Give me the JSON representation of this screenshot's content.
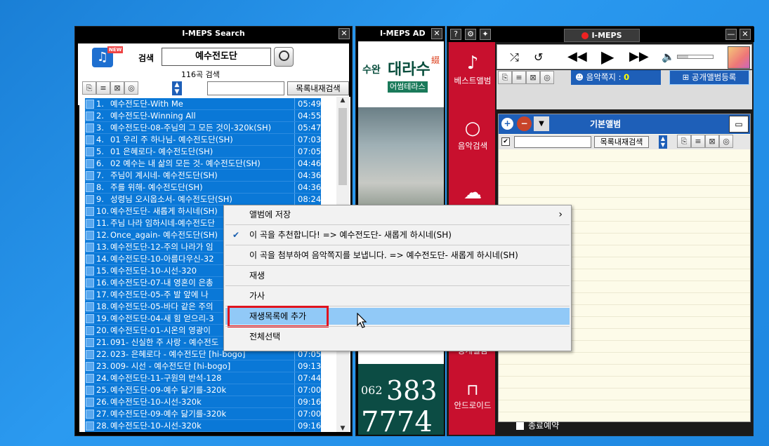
{
  "search_window": {
    "title": "I-MEPS Search",
    "close": "✕",
    "new_badge": "NEW",
    "search_label": "검색",
    "search_value": "예수전도단",
    "result_count": "116곡 검색",
    "filter_placeholder": "",
    "inlist_search_button": "목록내재검색",
    "rows": [
      {
        "num": "1.",
        "title": "예수전도단-With Me",
        "dur": "05:49"
      },
      {
        "num": "2.",
        "title": "예수전도단-Winning All",
        "dur": "04:55"
      },
      {
        "num": "3.",
        "title": "예수전도단-08-주님의 그 모든 것이-320k(SH)",
        "dur": "05:47"
      },
      {
        "num": "4.",
        "title": "01 우리 주 하나님- 예수전도단(SH)",
        "dur": "07:03"
      },
      {
        "num": "5.",
        "title": "01 은혜로다- 예수전도단(SH)",
        "dur": "07:05"
      },
      {
        "num": "6.",
        "title": "02 예수는 내 삶의 모든 것- 예수전도단(SH)",
        "dur": "04:46"
      },
      {
        "num": "7.",
        "title": "주님이 계시네- 예수전도단(SH)",
        "dur": "04:36"
      },
      {
        "num": "8.",
        "title": "주를 위해- 예수전도단(SH)",
        "dur": "04:36"
      },
      {
        "num": "9.",
        "title": "성령님 오시옵소서- 예수전도단(SH)",
        "dur": "08:24"
      },
      {
        "num": "10.",
        "title": "예수전도단- 새롭게 하시네(SH)",
        "dur": ""
      },
      {
        "num": "11.",
        "title": "주님 나라 임하시네-예수전도단",
        "dur": ""
      },
      {
        "num": "12.",
        "title": "Once_again- 예수전도단(SH)",
        "dur": ""
      },
      {
        "num": "13.",
        "title": "예수전도단-12-주의 나라가 임",
        "dur": ""
      },
      {
        "num": "14.",
        "title": "예수전도단-10-아름다우신-32",
        "dur": ""
      },
      {
        "num": "15.",
        "title": "예수전도단-10-시선-320",
        "dur": ""
      },
      {
        "num": "16.",
        "title": "예수전도단-07-내 영혼이 은총",
        "dur": ""
      },
      {
        "num": "17.",
        "title": "예수전도단-05-주 발 앞에 나",
        "dur": ""
      },
      {
        "num": "18.",
        "title": "예수전도단-05-바다 같은 주의",
        "dur": ""
      },
      {
        "num": "19.",
        "title": "예수전도단-04-새 힘 얻으리-3",
        "dur": ""
      },
      {
        "num": "20.",
        "title": "예수전도단-01-시온의 영광이",
        "dur": ""
      },
      {
        "num": "21.",
        "title": "091- 신실한 주 사랑 - 예수전도",
        "dur": ""
      },
      {
        "num": "22.",
        "title": "023- 은혜로다 - 예수전도단 [hi-bogo]",
        "dur": "07:05"
      },
      {
        "num": "23.",
        "title": "009- 시선 - 예수전도단 [hi-bogo]",
        "dur": "09:13"
      },
      {
        "num": "24.",
        "title": "예수전도단-11-구원의 반석-128",
        "dur": "07:44"
      },
      {
        "num": "25.",
        "title": "예수전도단-09-예수 닮기를-320k",
        "dur": "07:00"
      },
      {
        "num": "26.",
        "title": "예수전도단-10-시선-320k",
        "dur": "09:16"
      },
      {
        "num": "27.",
        "title": "예수전도단-09-예수 닮기를-320k",
        "dur": "07:00"
      },
      {
        "num": "28.",
        "title": "예수전도단-10-시선-320k",
        "dur": "09:16"
      }
    ]
  },
  "ad_window": {
    "title": "I-MEPS AD",
    "close": "✕",
    "brand_small": "수완",
    "brand_big": "대라수",
    "brand_sub": "어썸테라스",
    "seal": "綴",
    "phone_area": "062",
    "phone_1": "383",
    "phone_2": "7774"
  },
  "main_window": {
    "title": "I-MEPS",
    "help": "?",
    "settings": "⚙",
    "pin": "✦",
    "minimize": "—",
    "close": "✕",
    "sidebar": [
      {
        "label": "베스트앨범",
        "icon": "♪"
      },
      {
        "label": "음악검색",
        "icon": "○"
      },
      {
        "label": "",
        "icon": "☁"
      },
      {
        "label": "공개앨범",
        "icon": ""
      },
      {
        "label": "안드로이드",
        "icon": "⊓"
      }
    ],
    "message_label": "음악쪽지 :",
    "message_count": "0",
    "public_album_button": "공개앨범등록",
    "album_title": "기본앨범",
    "album_inlist_search": "목록내재검색",
    "shutdown_label": "종료예약"
  },
  "context_menu": {
    "items": [
      {
        "label": "앨범에 저장",
        "arrow": "›"
      },
      {
        "label": "이 곡을 추천합니다! => 예수전도단- 새롭게 하시네(SH)",
        "check": "✔"
      },
      {
        "label": "이 곡을 첨부하여 음악쪽지를 보냅니다. => 예수전도단- 새롭게 하시네(SH)"
      },
      {
        "label": "재생"
      },
      {
        "label": "가사"
      },
      {
        "label": "재생목록에 추가"
      },
      {
        "label": "전체선택"
      }
    ]
  },
  "colors": {
    "accent": "#0a78d7",
    "highlight": "#e0141e",
    "sidebar": "#c8102e",
    "menu_hover": "#91c9f7"
  }
}
